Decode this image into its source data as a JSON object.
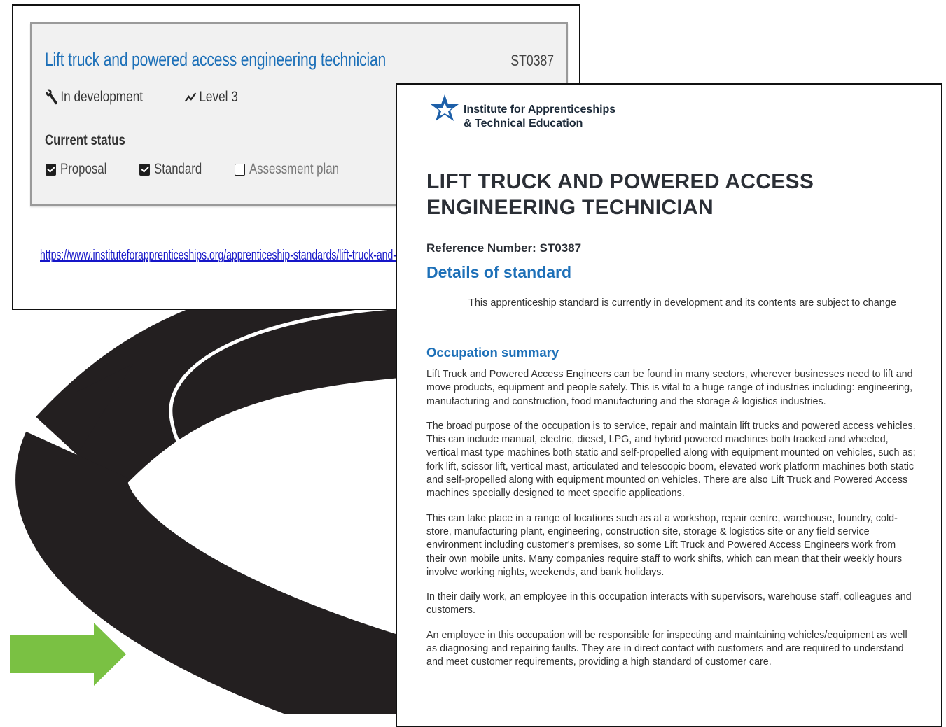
{
  "card": {
    "title": "Lift truck and powered access engineering technician",
    "code": "ST0387",
    "status": "In development",
    "level": "Level 3",
    "current_status_label": "Current status",
    "checks": [
      {
        "label": "Proposal",
        "checked": true
      },
      {
        "label": "Standard",
        "checked": true
      },
      {
        "label": "Assessment plan",
        "checked": false
      }
    ],
    "url": "https://www.instituteforapprenticeships.org/apprenticeship-standards/lift-truck-and-po"
  },
  "document": {
    "org_line1": "Institute for Apprenticeships",
    "org_line2": "& Technical Education",
    "title_line1": "LIFT TRUCK AND POWERED ACCESS",
    "title_line2": "ENGINEERING TECHNICIAN",
    "reference": "Reference Number: ST0387",
    "details_heading": "Details of standard",
    "notice": "This apprenticeship standard is currently in development and its contents are subject to change",
    "occupation_heading": "Occupation summary",
    "paragraphs": [
      "Lift Truck and Powered Access Engineers can be found in many sectors, wherever businesses need to lift and move products, equipment and people safely. This is vital to a huge range of industries including: engineering, manufacturing and construction, food manufacturing and the storage & logistics industries.",
      "The broad purpose of the occupation is to service, repair and maintain lift trucks and powered access vehicles. This can include manual, electric, diesel, LPG, and hybrid powered machines both tracked and wheeled, vertical mast type machines both static and self-propelled along with equipment mounted on vehicles, such as; fork lift, scissor lift, vertical mast, articulated and telescopic boom, elevated work platform machines both static and self-propelled along with equipment mounted on vehicles. There are also Lift Truck and Powered Access machines specially designed to meet specific applications.",
      "This can take place in a range of locations such as at a workshop, repair centre, warehouse, foundry, cold-store, manufacturing plant, engineering, construction site, storage & logistics site or any field service environment including customer's premises, so some Lift Truck and Powered Access Engineers work from their own mobile units. Many companies require staff to work shifts, which can mean that their weekly hours involve working nights, weekends, and bank holidays.",
      "In their daily work, an employee in this occupation interacts with supervisors, warehouse staff, colleagues and customers.",
      "An employee in this occupation will be responsible for inspecting and maintaining vehicles/equipment as well as diagnosing and repairing faults. They are in direct contact with customers and are required to understand and meet customer requirements, providing a high standard of customer care."
    ]
  },
  "colors": {
    "link_blue": "#1d70b8",
    "arrow_green": "#7ac143",
    "logo_blue": "#1d5fa8",
    "road": "#231f20"
  },
  "icons": [
    "wrench-icon",
    "trend-icon",
    "checkbox-icon",
    "star-logo-icon",
    "arrow-icon"
  ]
}
